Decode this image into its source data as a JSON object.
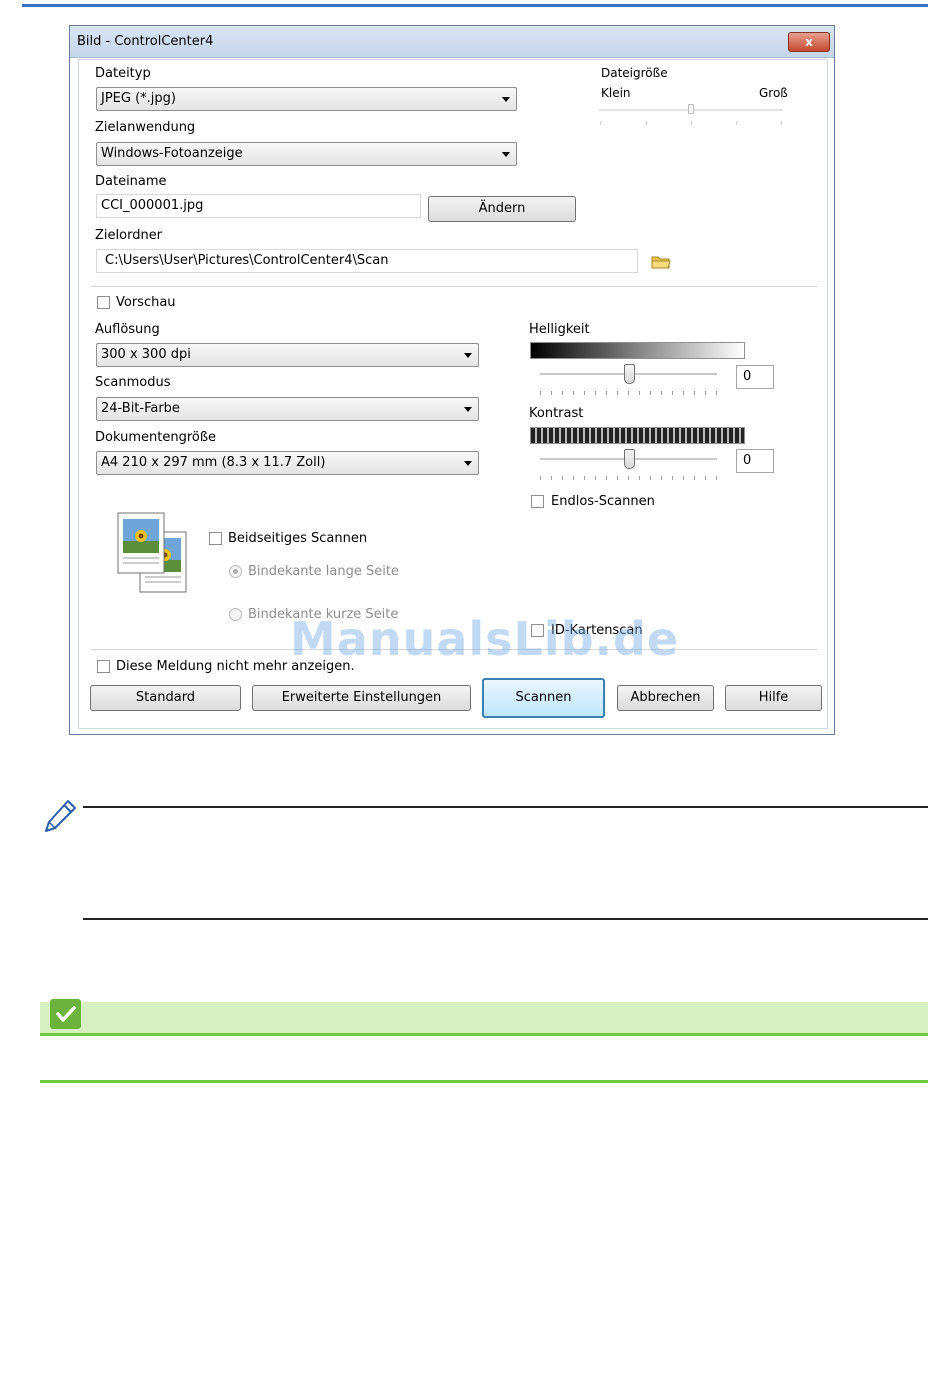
{
  "dialog": {
    "title": "Bild - ControlCenter4",
    "close_label": "x"
  },
  "file_type": {
    "label": "Dateityp",
    "value": "JPEG (*.jpg)"
  },
  "file_size": {
    "label": "Dateigröße",
    "min_label": "Klein",
    "max_label": "Groß"
  },
  "target_app": {
    "label": "Zielanwendung",
    "value": "Windows-Fotoanzeige"
  },
  "file_name": {
    "label": "Dateiname",
    "value": "CCI_000001.jpg",
    "change_button": "Ändern"
  },
  "target_folder": {
    "label": "Zielordner",
    "value": "C:\\Users\\User\\Pictures\\ControlCenter4\\Scan",
    "browse_icon": "folder-icon"
  },
  "preview": {
    "label": "Vorschau",
    "checked": false
  },
  "resolution": {
    "label": "Auflösung",
    "value": "300 x 300 dpi"
  },
  "scan_mode": {
    "label": "Scanmodus",
    "value": "24-Bit-Farbe"
  },
  "doc_size": {
    "label": "Dokumentengröße",
    "value": "A4 210 x 297 mm (8.3 x 11.7 Zoll)"
  },
  "brightness": {
    "label": "Helligkeit",
    "value": "0"
  },
  "contrast": {
    "label": "Kontrast",
    "value": "0"
  },
  "continuous_scan": {
    "label": "Endlos-Scannen",
    "checked": false
  },
  "duplex": {
    "label": "Beidseitiges Scannen",
    "checked": false,
    "long_edge": "Bindekante lange Seite",
    "short_edge": "Bindekante kurze Seite",
    "icon": "duplex-pages-icon"
  },
  "id_card": {
    "label": "ID-Kartenscan",
    "checked": false
  },
  "dont_show": {
    "label": "Diese Meldung nicht mehr anzeigen.",
    "checked": false
  },
  "buttons": {
    "default": "Standard",
    "advanced": "Erweiterte Einstellungen",
    "scan": "Scannen",
    "cancel": "Abbrechen",
    "help": "Hilfe"
  },
  "watermark": "ManualsLib.de",
  "note_icon": "pencil-icon",
  "check_icon": "checkmark-icon",
  "colors": {
    "accent": "#3b6fc2",
    "green": "#6dca3c",
    "green_bg": "#d6f0c2"
  }
}
